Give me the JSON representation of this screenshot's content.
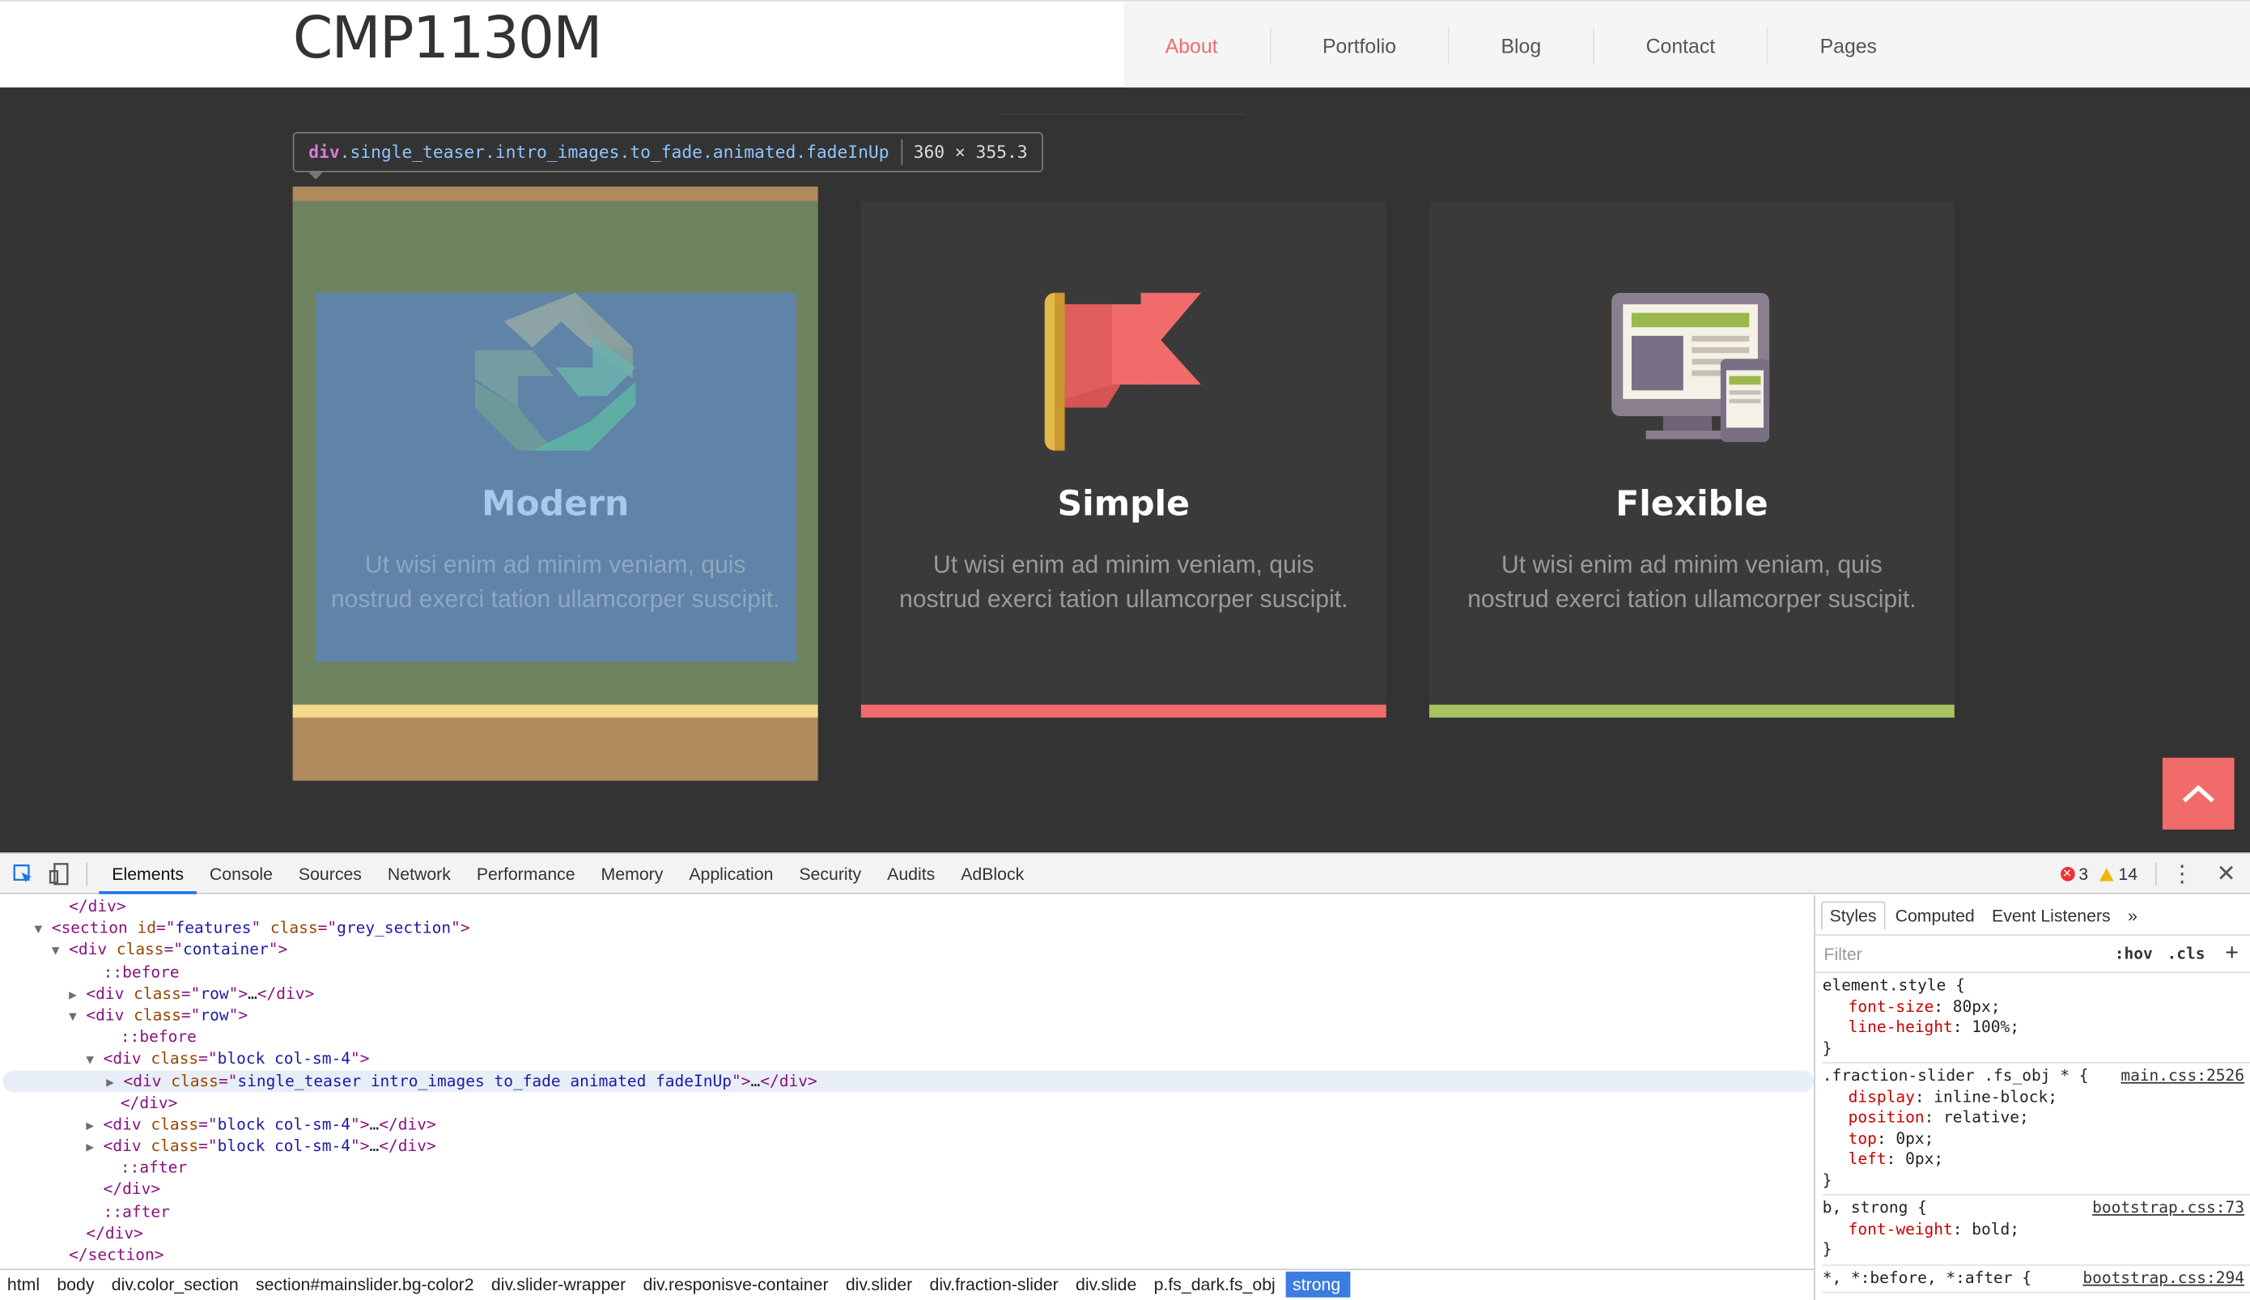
{
  "site": {
    "logo": "CMP1130M",
    "nav": [
      "About",
      "Portfolio",
      "Blog",
      "Contact",
      "Pages"
    ],
    "active_nav": "About"
  },
  "inspector_tooltip": {
    "tag": "div",
    "classes": ".single_teaser.intro_images.to_fade.animated.fadeInUp",
    "dims": "360 × 355.3"
  },
  "cards": [
    {
      "title": "Modern",
      "desc": "Ut wisi enim ad minim veniam, quis nostrud exerci tation ullamcorper suscipit.",
      "icon": "refresh-arrows-icon",
      "accent": "#f6d98b"
    },
    {
      "title": "Simple",
      "desc": "Ut wisi enim ad minim veniam, quis nostrud exerci tation ullamcorper suscipit.",
      "icon": "flag-icon",
      "accent": "#f26b6b"
    },
    {
      "title": "Flexible",
      "desc": "Ut wisi enim ad minim veniam, quis nostrud exerci tation ullamcorper suscipit.",
      "icon": "devices-icon",
      "accent": "#a5c35f"
    }
  ],
  "scroll_top_icon": "chevron-up-icon",
  "devtools": {
    "tabs": [
      "Elements",
      "Console",
      "Sources",
      "Network",
      "Performance",
      "Memory",
      "Application",
      "Security",
      "Audits",
      "AdBlock"
    ],
    "active_tab": "Elements",
    "errors": "3",
    "warnings": "14",
    "dom_lines": [
      {
        "indent": 3,
        "arrow": "",
        "html": "</div>"
      },
      {
        "indent": 2,
        "arrow": "▼",
        "html": "<section id=\"features\" class=\"grey_section\">"
      },
      {
        "indent": 3,
        "arrow": "▼",
        "html": "<div class=\"container\">"
      },
      {
        "indent": 5,
        "arrow": "",
        "html": "::before"
      },
      {
        "indent": 4,
        "arrow": "▶",
        "html": "<div class=\"row\">…</div>"
      },
      {
        "indent": 4,
        "arrow": "▼",
        "html": "<div class=\"row\">"
      },
      {
        "indent": 6,
        "arrow": "",
        "html": "::before"
      },
      {
        "indent": 5,
        "arrow": "▼",
        "html": "<div class=\"block col-sm-4\">"
      },
      {
        "indent": 6,
        "arrow": "▶",
        "html": "<div class=\"single_teaser intro_images to_fade animated fadeInUp\">…</div>"
      },
      {
        "indent": 6,
        "arrow": "",
        "html": "</div>"
      },
      {
        "indent": 5,
        "arrow": "▶",
        "html": "<div class=\"block col-sm-4\">…</div>"
      },
      {
        "indent": 5,
        "arrow": "▶",
        "html": "<div class=\"block col-sm-4\">…</div>"
      },
      {
        "indent": 6,
        "arrow": "",
        "html": "::after"
      },
      {
        "indent": 5,
        "arrow": "",
        "html": "</div>"
      },
      {
        "indent": 5,
        "arrow": "",
        "html": "::after"
      },
      {
        "indent": 4,
        "arrow": "",
        "html": "</div>"
      },
      {
        "indent": 3,
        "arrow": "",
        "html": "</section>"
      }
    ],
    "selected_line": 8,
    "breadcrumbs": [
      "html",
      "body",
      "div.color_section",
      "section#mainslider.bg-color2",
      "div.slider-wrapper",
      "div.responisve-container",
      "div.slider",
      "div.fraction-slider",
      "div.slide",
      "p.fs_dark.fs_obj",
      "strong"
    ],
    "active_crumb": "strong",
    "styles": {
      "tabs": [
        "Styles",
        "Computed",
        "Event Listeners",
        "»"
      ],
      "active_tab": "Styles",
      "filter_placeholder": "Filter",
      "hov": ":hov",
      "cls": ".cls",
      "plus": "+",
      "rules": [
        {
          "selector": "element.style {",
          "source": "",
          "props": [
            [
              "font-size",
              "80px;"
            ],
            [
              "line-height",
              "100%;"
            ]
          ]
        },
        {
          "selector": ".fraction-slider .fs_obj * {",
          "source": "main.css:2526",
          "props": [
            [
              "display",
              "inline-block;"
            ],
            [
              "position",
              "relative;"
            ],
            [
              "top",
              "0px;"
            ],
            [
              "left",
              "0px;"
            ]
          ]
        },
        {
          "selector": "b, strong {",
          "source": "bootstrap.css:73",
          "props": [
            [
              "font-weight",
              "bold;"
            ]
          ]
        },
        {
          "selector": "*, *:before, *:after {",
          "source": "bootstrap.css:294",
          "props": []
        }
      ]
    }
  }
}
